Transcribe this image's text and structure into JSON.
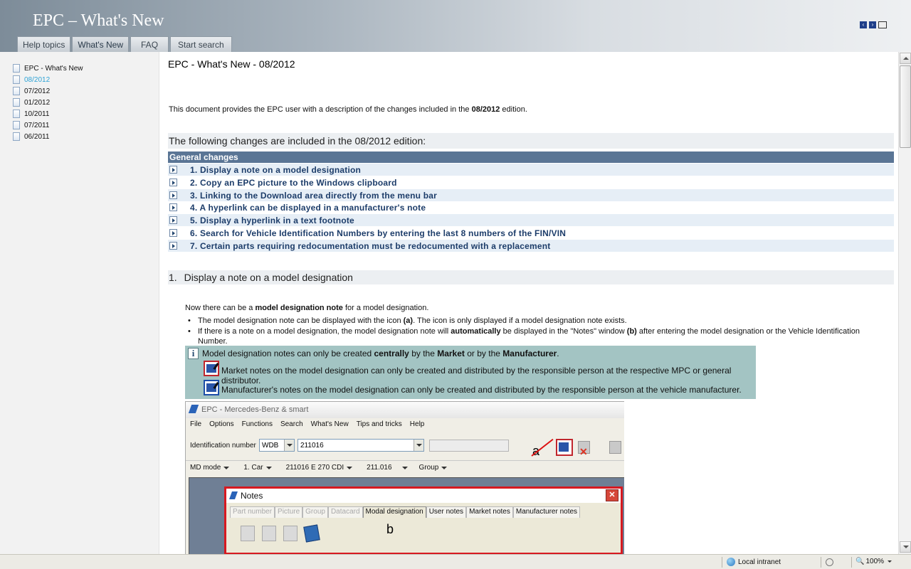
{
  "header": {
    "title": "EPC – What's New",
    "tabs": [
      {
        "label": "Help topics",
        "active": false
      },
      {
        "label": "What's New",
        "active": true
      },
      {
        "label": "FAQ",
        "active": false
      },
      {
        "label": "Start search",
        "active": false
      }
    ],
    "icons": [
      "nav-back-icon",
      "nav-forward-icon",
      "print-icon"
    ]
  },
  "sidebar": {
    "items": [
      {
        "label": "EPC - What's New",
        "active": false
      },
      {
        "label": "08/2012",
        "active": true
      },
      {
        "label": "07/2012",
        "active": false
      },
      {
        "label": "01/2012",
        "active": false
      },
      {
        "label": "10/2011",
        "active": false
      },
      {
        "label": "07/2011",
        "active": false
      },
      {
        "label": "06/2011",
        "active": false
      }
    ]
  },
  "main": {
    "title": "EPC - What's New - 08/2012",
    "intro_before": "This document provides the EPC user with a description of the changes included in the ",
    "intro_bold": "08/2012",
    "intro_after": " edition.",
    "changes_heading": "The following changes are included in the 08/2012 edition:",
    "general_bar": "General changes",
    "changes": [
      "1. Display a note on a model designation",
      "2. Copy an EPC picture to the Windows clipboard",
      "3. Linking to the Download area directly from the menu bar",
      "4. A hyperlink can be displayed in a manufacturer's note",
      "5. Display a hyperlink in a text footnote",
      "6. Search for Vehicle Identification Numbers by entering the last 8 numbers of the FIN/VIN",
      "7. Certain parts requiring redocumentation must be redocumented with a replacement"
    ],
    "section1_num": "1.",
    "section1_title": "Display a note on a model designation",
    "para_before": "Now there can be a ",
    "para_bold": "model designation note",
    "para_after": " for a model designation.",
    "bullet1_a": "The model designation note can be displayed with the icon ",
    "bullet1_b": "(a)",
    "bullet1_c": ". The icon is only displayed if a model designation note exists.",
    "bullet2_a": "If there is a note on a model designation, the model designation note will ",
    "bullet2_b": "automatically",
    "bullet2_c": " be displayed in the \"Notes\" window ",
    "bullet2_d": "(b)",
    "bullet2_e": " after entering the model designation or the Vehicle Identification Number.",
    "info_a": "Model designation notes can only be created ",
    "info_b": "centrally",
    "info_c": " by the ",
    "info_d": "Market",
    "info_e": " or by the ",
    "info_f": "Manufacturer",
    "info_g": ".",
    "info_market": "Market notes on the model designation can only be created and distributed by the responsible person at the respective MPC or general distributor.",
    "info_manufacturer": "Manufacturer's notes on the model designation can only be created and distributed by the responsible person at the vehicle manufacturer."
  },
  "screenshot": {
    "title": "EPC - Mercedes-Benz & smart",
    "menu": [
      "File",
      "Options",
      "Functions",
      "Search",
      "What's New",
      "Tips and tricks",
      "Help"
    ],
    "id_label": "Identification number",
    "id_prefix": "WDB",
    "id_value": "211016",
    "callout_a": "a",
    "md_row": [
      "MD mode",
      "1. Car",
      "211016 E 270 CDI",
      "211.016",
      "Group"
    ],
    "notes_title": "Notes",
    "notes_close": "✕",
    "notes_tabs": [
      {
        "label": "Part number",
        "state": "disabled"
      },
      {
        "label": "Picture",
        "state": "disabled"
      },
      {
        "label": "Group",
        "state": "disabled"
      },
      {
        "label": "Datacard",
        "state": "disabled"
      },
      {
        "label": "Modal designation",
        "state": "selected"
      },
      {
        "label": "User notes",
        "state": "normal"
      },
      {
        "label": "Market notes",
        "state": "normal"
      },
      {
        "label": "Manufacturer notes",
        "state": "normal"
      }
    ],
    "callout_b": "b"
  },
  "statusbar": {
    "zone": "Local intranet",
    "zoom": "100%"
  }
}
